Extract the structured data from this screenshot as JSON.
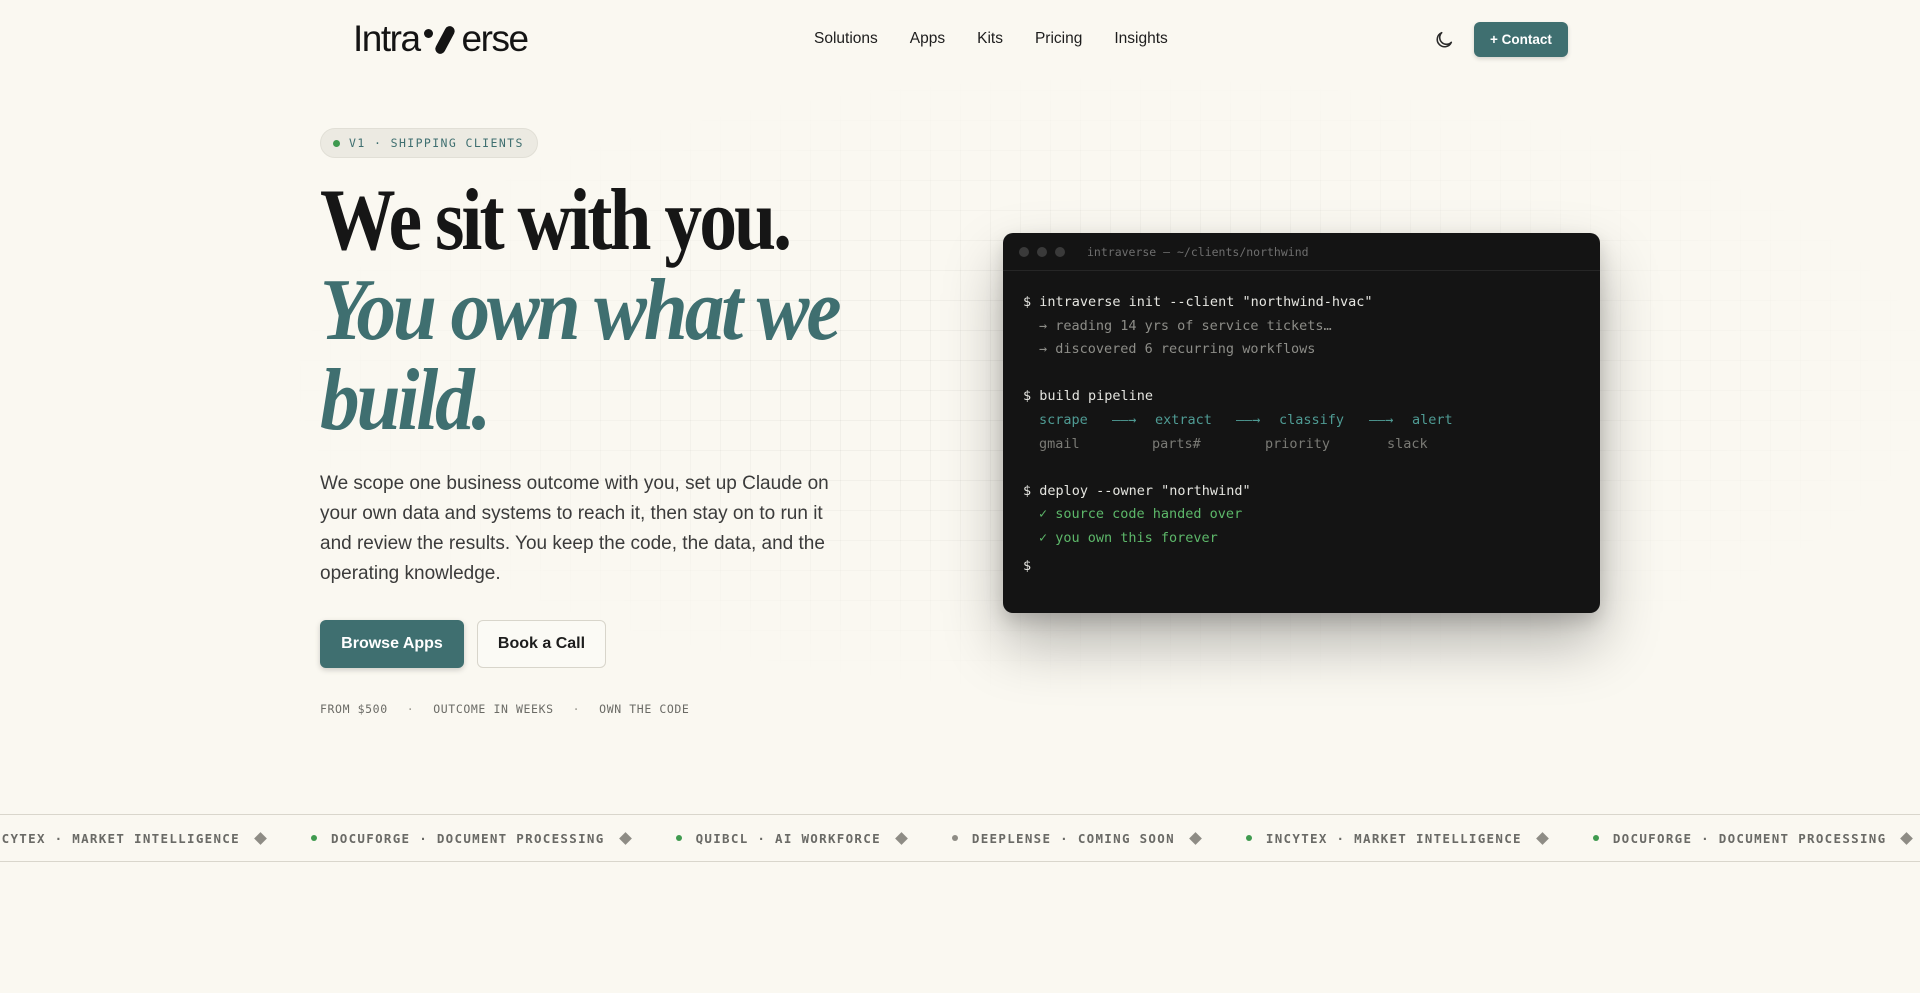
{
  "header": {
    "logo": {
      "left": "Intra",
      "right": "erse"
    },
    "nav": [
      "Solutions",
      "Apps",
      "Kits",
      "Pricing",
      "Insights"
    ],
    "contact_label": "+ Contact"
  },
  "hero": {
    "badge": "V1 · SHIPPING CLIENTS",
    "headline_line1": "We sit with you.",
    "headline_line2": "You own what we",
    "headline_line3": "build.",
    "lede": "We scope one business outcome with you, set up Claude on your own data and systems to reach it, then stay on to run it and review the results. You keep the code, the data, and the operating knowledge.",
    "primary_cta": "Browse Apps",
    "secondary_cta": "Book a Call",
    "meta": [
      "FROM $500",
      "OUTCOME IN WEEKS",
      "OWN THE CODE"
    ],
    "meta_sep": "·"
  },
  "terminal": {
    "title": "intraverse — ~/clients/northwind",
    "cmd1": "$ intraverse init --client \"northwind-hvac\"",
    "out1": "→ reading 14 yrs of service tickets…",
    "out2": "→ discovered 6 recurring workflows",
    "cmd2": "$ build pipeline",
    "stages": [
      "scrape",
      "extract",
      "classify",
      "alert"
    ],
    "stage_arrow": "——→",
    "sources": [
      "gmail",
      "parts#",
      "priority",
      "slack"
    ],
    "cmd3": "$ deploy --owner \"northwind\"",
    "ok1": "✓ source code handed over",
    "ok2": "✓ you own this forever",
    "prompt": "$"
  },
  "ticker": {
    "items": [
      {
        "text": "INCYTEX · MARKET INTELLIGENCE",
        "status": "live"
      },
      {
        "text": "DOCUFORGE · DOCUMENT PROCESSING",
        "status": "live"
      },
      {
        "text": "QUIBCL · AI WORKFORCE",
        "status": "live"
      },
      {
        "text": "DEEPLENSE · COMING SOON",
        "status": "soon"
      },
      {
        "text": "INCYTEX · MARKET INTELLIGENCE",
        "status": "live"
      },
      {
        "text": "DOCUFORGE · DOCUMENT PROCESSING",
        "status": "live"
      }
    ]
  },
  "colors": {
    "accent": "#3f6f70",
    "live_dot": "#3f9a4f",
    "soon_dot": "#8e8c85",
    "terminal_bg": "#141414",
    "background": "#faf8f1"
  },
  "icons": {
    "theme_toggle": "moon-icon"
  }
}
